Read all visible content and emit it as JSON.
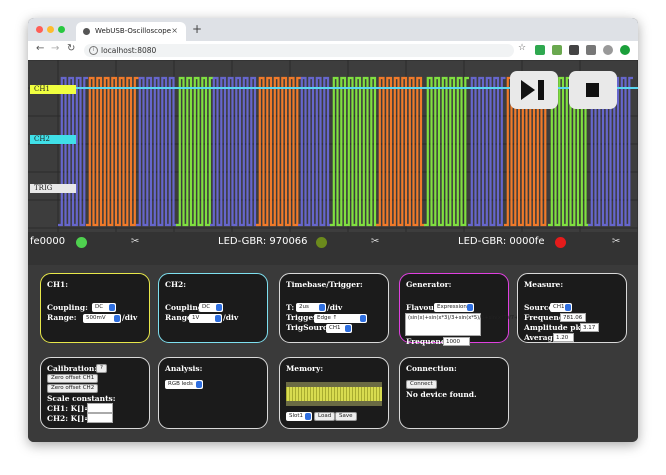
{
  "browser": {
    "tab_title": "WebUSB-Oscilloscope",
    "tab_close": "×",
    "new_tab": "+",
    "url": "localhost:8080",
    "back": "←",
    "forward": "→",
    "reload": "↻"
  },
  "scope": {
    "ch1_label": "CH1",
    "ch2_label": "CH2",
    "trig_label": "TRIG",
    "status": [
      {
        "text": "fe0000",
        "led_color": "#4fd14f"
      },
      {
        "text": "LED-GBR: 970066",
        "led_color": "#6b8a1c"
      },
      {
        "text": "LED-GBR: 0000fe",
        "led_color": "#e51b1b"
      }
    ],
    "scissors": "✂",
    "colors": {
      "ch1": "#f0ff40",
      "ch2": "#40e0e8",
      "orange": "#f07a2a",
      "blue": "#6666cc",
      "green": "#80e040",
      "cyan": "#5ad6f0"
    }
  },
  "ch1": {
    "title": "CH1:",
    "coupling_label": "Coupling:",
    "coupling": "DC",
    "range_label": "Range:",
    "range": "500mV",
    "unit": "/div",
    "border": "#e8e84a"
  },
  "ch2": {
    "title": "CH2:",
    "coupling_label": "Coupling:",
    "coupling": "DC",
    "range_label": "Range:",
    "range": "1V",
    "unit": "/div",
    "border": "#7ee0f0"
  },
  "timebase": {
    "title": "Timebase/Trigger:",
    "t_label": "T:",
    "t": "2us",
    "t_unit": "/div",
    "trigger_label": "Trigger:",
    "trigger": "Edge ↑",
    "source_label": "TrigSource:",
    "source": "CH1"
  },
  "generator": {
    "title": "Generator:",
    "flavour_label": "Flavour:",
    "flavour": "Expression",
    "expression": "(sin(x)+sin(x*3)/3+sin(x*5)/5+sin(x*7)/7+sin(x*9)/9+sin(x*11)/11)/2",
    "expression_display": "(sin(x)+sin(x*3)/3+sin(x*5)/5+sin(x*7)/7+sin(x*9)/9+sin(x*11)/11)/2",
    "frequency_label": "Frequency:",
    "frequency": "1000",
    "border": "#e040e0"
  },
  "measure": {
    "title": "Measure:",
    "source_label": "Source:",
    "source": "CH1",
    "frequency_label": "Frequency:",
    "frequency": "781.06 kl",
    "amplitude_label": "Amplitude pk-pk:",
    "amplitude": "3.17 V",
    "average_label": "Average:",
    "average": "1.20 V"
  },
  "calibration": {
    "title": "Calibration:",
    "help": "?",
    "zero_ch1": "Zero offset CH1",
    "zero_ch2": "Zero offset CH2",
    "scale_label": "Scale constants:",
    "ch1_k": "CH1: K[]=",
    "ch2_k": "CH2: K[]="
  },
  "analysis": {
    "title": "Analysis:",
    "mode": "RGB leds"
  },
  "memory": {
    "title": "Memory:",
    "slot": "Slot1",
    "load": "Load",
    "save": "Save"
  },
  "connection": {
    "title": "Connection:",
    "connect": "Connect",
    "status": "No device found."
  }
}
